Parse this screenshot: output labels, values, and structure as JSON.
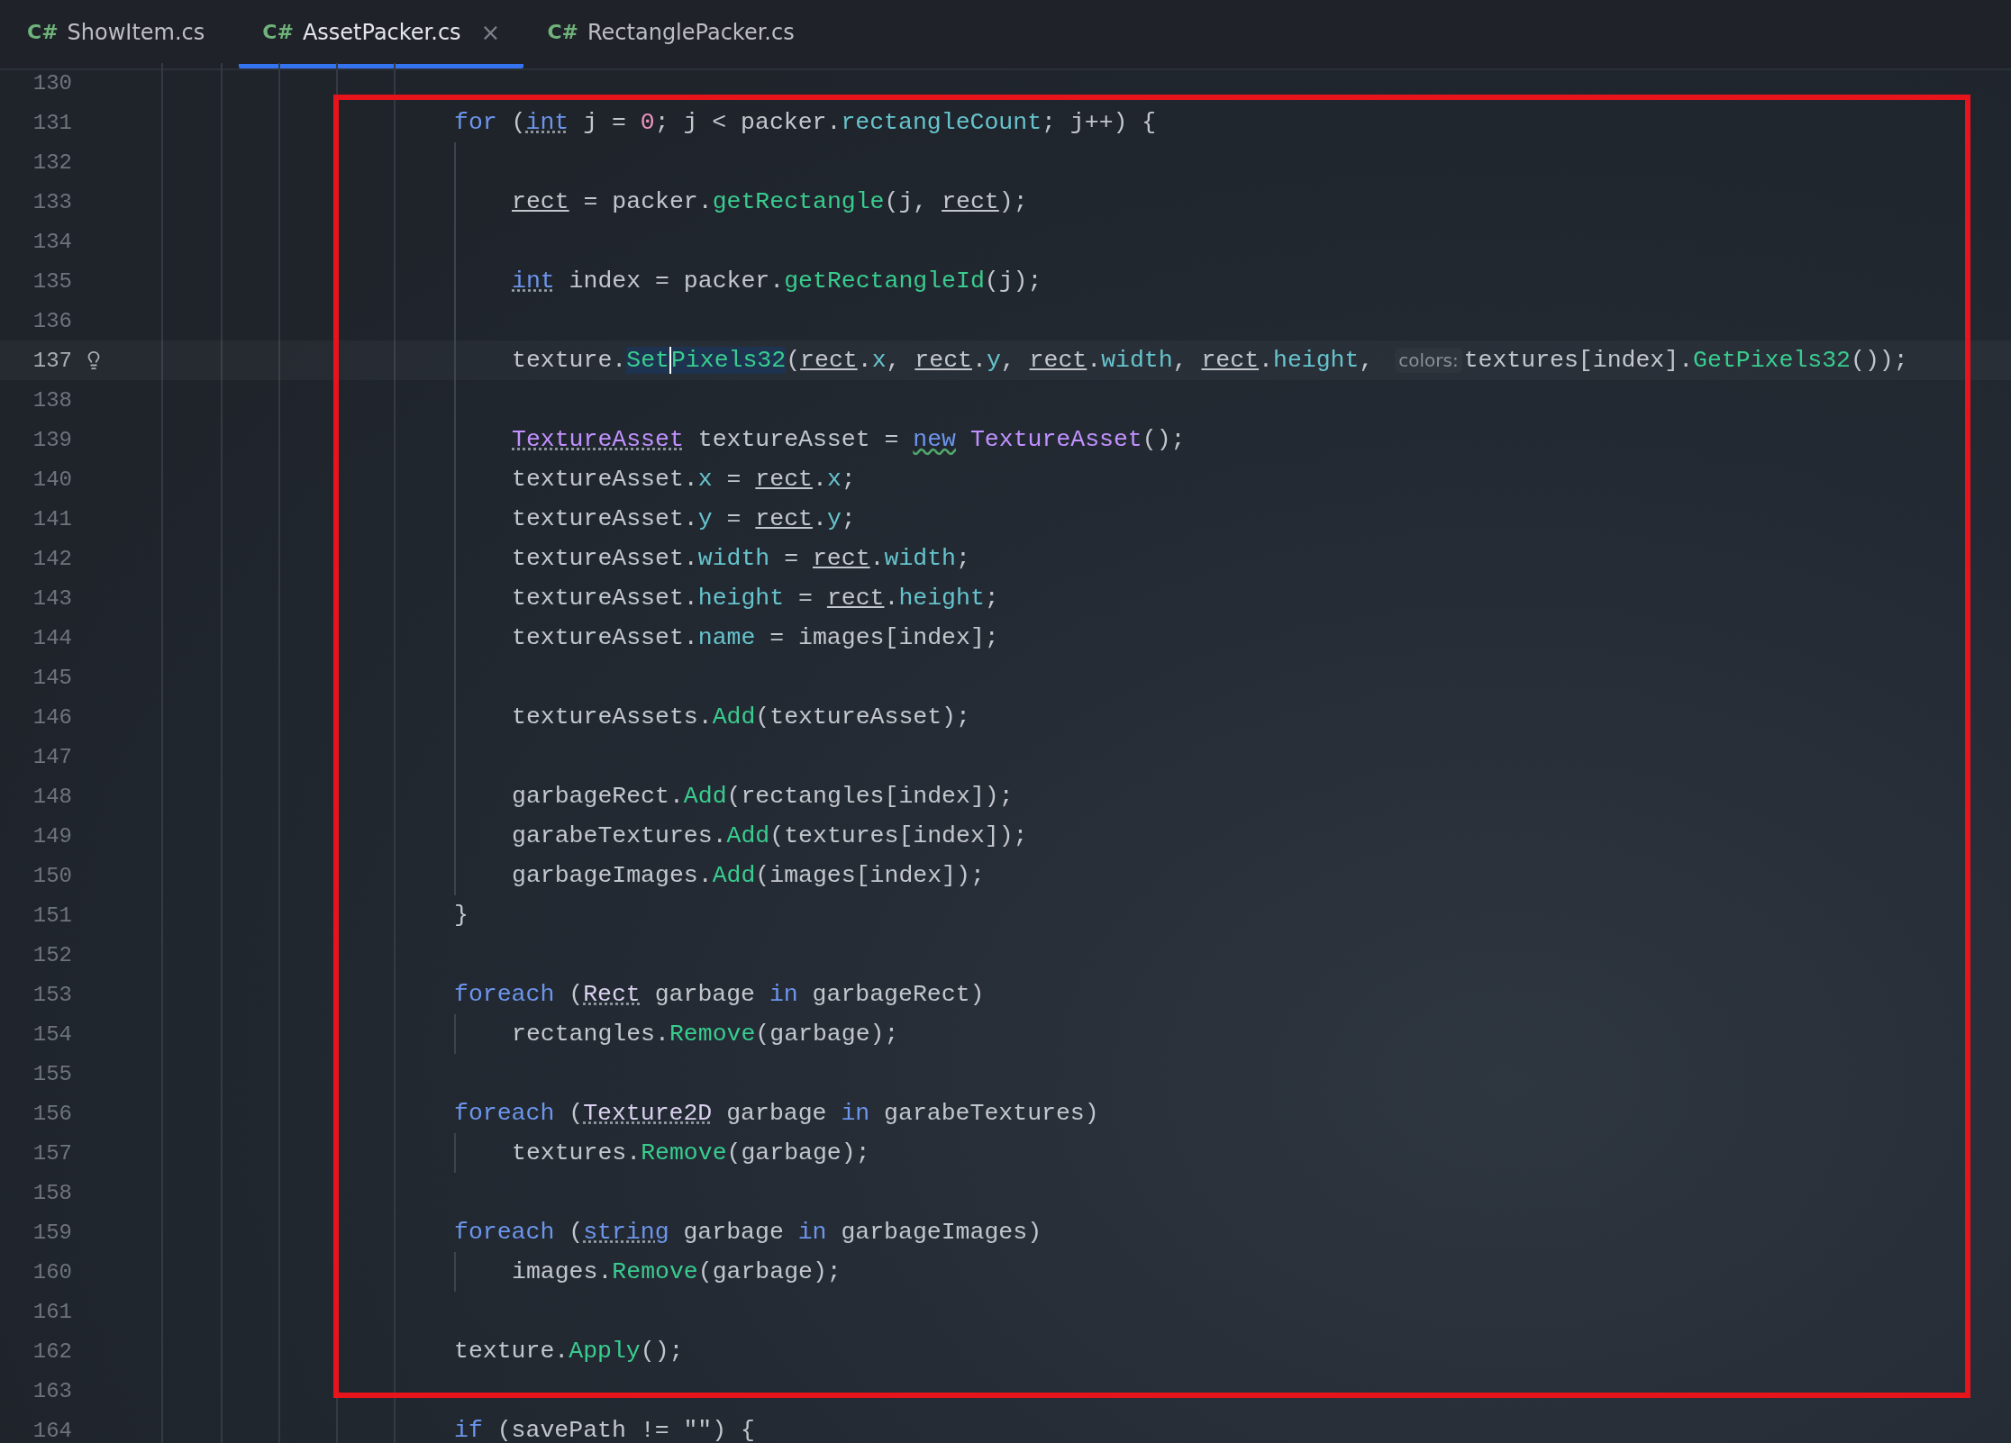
{
  "tabs": [
    {
      "badge": "C#",
      "label": "ShowItem.cs",
      "selected": false
    },
    {
      "badge": "C#",
      "label": "AssetPacker.cs",
      "selected": true,
      "close": "×"
    },
    {
      "badge": "C#",
      "label": "RectanglePacker.cs",
      "selected": false
    }
  ],
  "lines": [
    {
      "number": "130",
      "current": false
    },
    {
      "number": "131",
      "current": false,
      "tokens": [
        {
          "text": "for",
          "kind": "keyword"
        },
        {
          "text": " (",
          "kind": "plain"
        },
        {
          "text": "int",
          "kind": "warnkeyword"
        },
        {
          "text": " j = ",
          "kind": "plain"
        },
        {
          "text": "0",
          "kind": "number"
        },
        {
          "text": "; j < packer.",
          "kind": "plain"
        },
        {
          "text": "rectangleCount",
          "kind": "field"
        },
        {
          "text": "; j++) {",
          "kind": "plain"
        }
      ],
      "children": [
        {
          "number": "132",
          "current": false
        },
        {
          "number": "133",
          "current": false,
          "tokens": [
            {
              "text": "rect",
              "kind": "local"
            },
            {
              "text": " = packer.",
              "kind": "plain"
            },
            {
              "text": "getRectangle",
              "kind": "method"
            },
            {
              "text": "(j, ",
              "kind": "plain"
            },
            {
              "text": "rect",
              "kind": "local"
            },
            {
              "text": ");",
              "kind": "plain"
            }
          ]
        },
        {
          "number": "134",
          "current": false
        },
        {
          "number": "135",
          "current": false,
          "tokens": [
            {
              "text": "int",
              "kind": "warnkeyword"
            },
            {
              "text": " index = packer.",
              "kind": "plain"
            },
            {
              "text": "getRectangleId",
              "kind": "method"
            },
            {
              "text": "(j);",
              "kind": "plain"
            }
          ]
        },
        {
          "number": "136",
          "current": false
        },
        {
          "number": "137",
          "current": true,
          "tokens": [
            {
              "text": "texture.",
              "kind": "plain"
            },
            {
              "text": "Set",
              "kind": "caret"
            },
            {
              "text": "Pixels32",
              "kind": "selected"
            },
            {
              "text": "(",
              "kind": "plain"
            },
            {
              "text": "rect",
              "kind": "local"
            },
            {
              "text": ".",
              "kind": "plain"
            },
            {
              "text": "x",
              "kind": "field"
            },
            {
              "text": ", ",
              "kind": "plain"
            },
            {
              "text": "rect",
              "kind": "local"
            },
            {
              "text": ".",
              "kind": "plain"
            },
            {
              "text": "y",
              "kind": "field"
            },
            {
              "text": ", ",
              "kind": "plain"
            },
            {
              "text": "rect",
              "kind": "local"
            },
            {
              "text": ".",
              "kind": "plain"
            },
            {
              "text": "width",
              "kind": "field"
            },
            {
              "text": ", ",
              "kind": "plain"
            },
            {
              "text": "rect",
              "kind": "local"
            },
            {
              "text": ".",
              "kind": "plain"
            },
            {
              "text": "height",
              "kind": "field"
            },
            {
              "text": ", ",
              "kind": "plain"
            },
            {
              "text": "colors:",
              "kind": "hint"
            },
            {
              "text": "textures[index].",
              "kind": "plain"
            },
            {
              "text": "GetPixels32",
              "kind": "method"
            },
            {
              "text": "());",
              "kind": "plain"
            }
          ]
        },
        {
          "number": "138",
          "current": false
        },
        {
          "number": "139",
          "current": false,
          "tokens": [
            {
              "text": "TextureAsset",
              "kind": "warntype"
            },
            {
              "text": " textureAsset = ",
              "kind": "plain"
            },
            {
              "text": "new",
              "kind": "typo"
            },
            {
              "text": " TextureAsset",
              "kind": "type"
            },
            {
              "text": "();",
              "kind": "plain"
            }
          ]
        },
        {
          "number": "140",
          "current": false,
          "tokens": [
            {
              "text": "textureAsset.",
              "kind": "plain"
            },
            {
              "text": "x",
              "kind": "field"
            },
            {
              "text": " = ",
              "kind": "plain"
            },
            {
              "text": "rect",
              "kind": "local"
            },
            {
              "text": ".",
              "kind": "plain"
            },
            {
              "text": "x",
              "kind": "field"
            },
            {
              "text": ";",
              "kind": "plain"
            }
          ]
        },
        {
          "number": "141",
          "current": false,
          "tokens": [
            {
              "text": "textureAsset.",
              "kind": "plain"
            },
            {
              "text": "y",
              "kind": "field"
            },
            {
              "text": " = ",
              "kind": "plain"
            },
            {
              "text": "rect",
              "kind": "local"
            },
            {
              "text": ".",
              "kind": "plain"
            },
            {
              "text": "y",
              "kind": "field"
            },
            {
              "text": ";",
              "kind": "plain"
            }
          ]
        },
        {
          "number": "142",
          "current": false,
          "tokens": [
            {
              "text": "textureAsset.",
              "kind": "plain"
            },
            {
              "text": "width",
              "kind": "field"
            },
            {
              "text": " = ",
              "kind": "plain"
            },
            {
              "text": "rect",
              "kind": "local"
            },
            {
              "text": ".",
              "kind": "plain"
            },
            {
              "text": "width",
              "kind": "field"
            },
            {
              "text": ";",
              "kind": "plain"
            }
          ]
        },
        {
          "number": "143",
          "current": false,
          "tokens": [
            {
              "text": "textureAsset.",
              "kind": "plain"
            },
            {
              "text": "height",
              "kind": "field"
            },
            {
              "text": " = ",
              "kind": "plain"
            },
            {
              "text": "rect",
              "kind": "local"
            },
            {
              "text": ".",
              "kind": "plain"
            },
            {
              "text": "height",
              "kind": "field"
            },
            {
              "text": ";",
              "kind": "plain"
            }
          ]
        },
        {
          "number": "144",
          "current": false,
          "tokens": [
            {
              "text": "textureAsset.",
              "kind": "plain"
            },
            {
              "text": "name",
              "kind": "field"
            },
            {
              "text": " = images[index];",
              "kind": "plain"
            }
          ]
        },
        {
          "number": "145",
          "current": false
        },
        {
          "number": "146",
          "current": false,
          "tokens": [
            {
              "text": "textureAssets.",
              "kind": "plain"
            },
            {
              "text": "Add",
              "kind": "method"
            },
            {
              "text": "(textureAsset);",
              "kind": "plain"
            }
          ]
        },
        {
          "number": "147",
          "current": false
        },
        {
          "number": "148",
          "current": false,
          "tokens": [
            {
              "text": "garbageRect.",
              "kind": "plain"
            },
            {
              "text": "Add",
              "kind": "method"
            },
            {
              "text": "(rectangles[index]);",
              "kind": "plain"
            }
          ]
        },
        {
          "number": "149",
          "current": false,
          "tokens": [
            {
              "text": "garabeTextures.",
              "kind": "plain"
            },
            {
              "text": "Add",
              "kind": "method"
            },
            {
              "text": "(textures[index]);",
              "kind": "plain"
            }
          ]
        },
        {
          "number": "150",
          "current": false,
          "tokens": [
            {
              "text": "garbageImages.",
              "kind": "plain"
            },
            {
              "text": "Add",
              "kind": "method"
            },
            {
              "text": "(images[index]);",
              "kind": "plain"
            }
          ]
        }
      ]
    },
    {
      "number": "151",
      "current": false,
      "tokens": [
        {
          "text": "}",
          "kind": "plain"
        }
      ]
    },
    {
      "number": "152",
      "current": false
    },
    {
      "number": "153",
      "current": false,
      "tokens": [
        {
          "text": "foreach",
          "kind": "keyword"
        },
        {
          "text": " (",
          "kind": "plain"
        },
        {
          "text": "Rect",
          "kind": "warnclass"
        },
        {
          "text": " garbage ",
          "kind": "plain"
        },
        {
          "text": "in",
          "kind": "keyword"
        },
        {
          "text": " garbageRect)",
          "kind": "plain"
        }
      ],
      "children": [
        {
          "number": "154",
          "current": false,
          "tokens": [
            {
              "text": "rectangles.",
              "kind": "plain"
            },
            {
              "text": "Remove",
              "kind": "method"
            },
            {
              "text": "(garbage);",
              "kind": "plain"
            }
          ]
        }
      ]
    },
    {
      "number": "155",
      "current": false
    },
    {
      "number": "156",
      "current": false,
      "tokens": [
        {
          "text": "foreach",
          "kind": "keyword"
        },
        {
          "text": " (",
          "kind": "plain"
        },
        {
          "text": "Texture2D",
          "kind": "warnclass"
        },
        {
          "text": " garbage ",
          "kind": "plain"
        },
        {
          "text": "in",
          "kind": "keyword"
        },
        {
          "text": " garabeTextures)",
          "kind": "plain"
        }
      ],
      "children": [
        {
          "number": "157",
          "current": false,
          "tokens": [
            {
              "text": "textures.",
              "kind": "plain"
            },
            {
              "text": "Remove",
              "kind": "method"
            },
            {
              "text": "(garbage);",
              "kind": "plain"
            }
          ]
        }
      ]
    },
    {
      "number": "158",
      "current": false
    },
    {
      "number": "159",
      "current": false,
      "tokens": [
        {
          "text": "foreach",
          "kind": "keyword"
        },
        {
          "text": " (",
          "kind": "plain"
        },
        {
          "text": "string",
          "kind": "warnkeyword"
        },
        {
          "text": " garbage ",
          "kind": "plain"
        },
        {
          "text": "in",
          "kind": "keyword"
        },
        {
          "text": " garbageImages)",
          "kind": "plain"
        }
      ],
      "children": [
        {
          "number": "160",
          "current": false,
          "tokens": [
            {
              "text": "images.",
              "kind": "plain"
            },
            {
              "text": "Remove",
              "kind": "method"
            },
            {
              "text": "(garbage);",
              "kind": "plain"
            }
          ]
        }
      ]
    },
    {
      "number": "161",
      "current": false
    },
    {
      "number": "162",
      "current": false,
      "tokens": [
        {
          "text": "texture.",
          "kind": "plain"
        },
        {
          "text": "Apply",
          "kind": "method"
        },
        {
          "text": "();",
          "kind": "plain"
        }
      ]
    },
    {
      "number": "163",
      "current": false
    },
    {
      "number": "164",
      "current": false,
      "tokens": [
        {
          "text": "if",
          "kind": "keyword"
        },
        {
          "text": " (savePath != \"\") {",
          "kind": "plain"
        }
      ]
    }
  ]
}
